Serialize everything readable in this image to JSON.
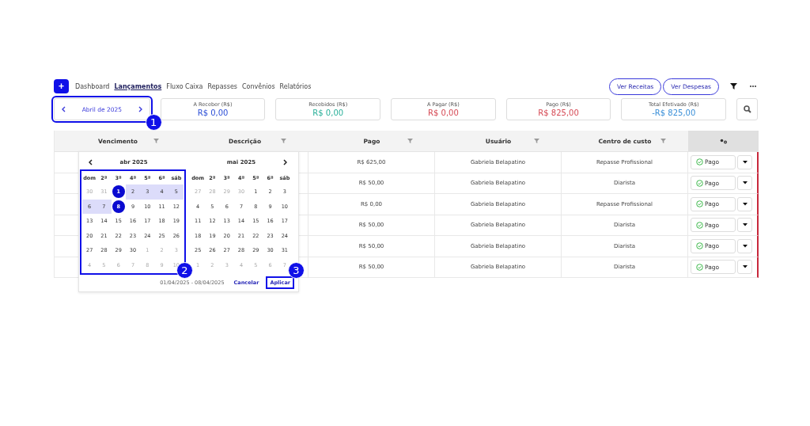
{
  "nav": {
    "add_label": "+",
    "links": [
      {
        "label": "Dashboard",
        "selected": false
      },
      {
        "label": "Lançamentos",
        "selected": true
      },
      {
        "label": "Fluxo Caixa",
        "selected": false
      },
      {
        "label": "Repasses",
        "selected": false
      },
      {
        "label": "Convênios",
        "selected": false
      },
      {
        "label": "Relatórios",
        "selected": false
      }
    ],
    "buttons": [
      "Ver Receitas",
      "Ver Despesas"
    ]
  },
  "month_nav": {
    "label": "Abril de 2025",
    "callout": "1"
  },
  "summary": [
    {
      "label": "A Receber (R$)",
      "value": "R$ 0,00",
      "color": "#2d4fd6"
    },
    {
      "label": "Recebidos (R$)",
      "value": "R$ 0,00",
      "color": "#2ab09a"
    },
    {
      "label": "A Pagar (R$)",
      "value": "R$ 0,00",
      "color": "#d64a55"
    },
    {
      "label": "Pago (R$)",
      "value": "R$ 825,00",
      "color": "#d64a55"
    },
    {
      "label": "Total Efetivado (R$)",
      "value": "-R$ 825,00",
      "color": "#3a8fd8"
    }
  ],
  "table": {
    "columns": [
      "Vencimento",
      "Descrição",
      "Pago",
      "Usuário",
      "Centro de custo"
    ],
    "rows": [
      {
        "pago": "R$ 625,00",
        "usuario": "Gabriela Belapatino",
        "centro": "Repasse Profissional",
        "status": "Pago",
        "color": "#c8283c"
      },
      {
        "pago": "R$ 50,00",
        "usuario": "Gabriela Belapatino",
        "centro": "Diarista",
        "status": "Pago",
        "color": "#c8283c"
      },
      {
        "pago": "R$ 0,00",
        "usuario": "Gabriela Belapatino",
        "centro": "Repasse Profissional",
        "status": "Pago",
        "color": "#c8283c"
      },
      {
        "pago": "R$ 50,00",
        "usuario": "Gabriela Belapatino",
        "centro": "Diarista",
        "status": "Pago",
        "color": "#c8283c"
      },
      {
        "pago": "R$ 50,00",
        "usuario": "Gabriela Belapatino",
        "centro": "Diarista",
        "status": "Pago",
        "color": "#c8283c"
      },
      {
        "pago": "R$ 50,00",
        "usuario": "Gabriela Belapatino",
        "centro": "Diarista",
        "status": "Pago",
        "color": "#c8283c"
      }
    ]
  },
  "datepicker": {
    "months": [
      {
        "title": "abr 2025",
        "callout": "2",
        "weekdays": [
          "dom",
          "2ª",
          "3ª",
          "4ª",
          "5ª",
          "6ª",
          "sáb"
        ],
        "days": [
          {
            "day": "30",
            "kind": "outside",
            "selected": false,
            "in_range": false
          },
          {
            "day": "31",
            "kind": "outside",
            "selected": false,
            "in_range": false
          },
          {
            "day": "1",
            "kind": "inside",
            "selected": true,
            "in_range": false
          },
          {
            "day": "2",
            "kind": "inside",
            "selected": false,
            "in_range": true
          },
          {
            "day": "3",
            "kind": "inside",
            "selected": false,
            "in_range": true
          },
          {
            "day": "4",
            "kind": "inside",
            "selected": false,
            "in_range": true
          },
          {
            "day": "5",
            "kind": "inside",
            "selected": false,
            "in_range": true
          },
          {
            "day": "6",
            "kind": "inside",
            "selected": false,
            "in_range": true
          },
          {
            "day": "7",
            "kind": "inside",
            "selected": false,
            "in_range": true
          },
          {
            "day": "8",
            "kind": "inside",
            "selected": true,
            "in_range": false
          },
          {
            "day": "9",
            "kind": "inside",
            "selected": false,
            "in_range": false
          },
          {
            "day": "10",
            "kind": "inside",
            "selected": false,
            "in_range": false
          },
          {
            "day": "11",
            "kind": "inside",
            "selected": false,
            "in_range": false
          },
          {
            "day": "12",
            "kind": "inside",
            "selected": false,
            "in_range": false
          },
          {
            "day": "13",
            "kind": "inside",
            "selected": false,
            "in_range": false
          },
          {
            "day": "14",
            "kind": "inside",
            "selected": false,
            "in_range": false
          },
          {
            "day": "15",
            "kind": "inside",
            "selected": false,
            "in_range": false
          },
          {
            "day": "16",
            "kind": "inside",
            "selected": false,
            "in_range": false
          },
          {
            "day": "17",
            "kind": "inside",
            "selected": false,
            "in_range": false
          },
          {
            "day": "18",
            "kind": "inside",
            "selected": false,
            "in_range": false
          },
          {
            "day": "19",
            "kind": "inside",
            "selected": false,
            "in_range": false
          },
          {
            "day": "20",
            "kind": "inside",
            "selected": false,
            "in_range": false
          },
          {
            "day": "21",
            "kind": "inside",
            "selected": false,
            "in_range": false
          },
          {
            "day": "22",
            "kind": "inside",
            "selected": false,
            "in_range": false
          },
          {
            "day": "23",
            "kind": "inside",
            "selected": false,
            "in_range": false
          },
          {
            "day": "24",
            "kind": "inside",
            "selected": false,
            "in_range": false
          },
          {
            "day": "25",
            "kind": "inside",
            "selected": false,
            "in_range": false
          },
          {
            "day": "26",
            "kind": "inside",
            "selected": false,
            "in_range": false
          },
          {
            "day": "27",
            "kind": "inside",
            "selected": false,
            "in_range": false
          },
          {
            "day": "28",
            "kind": "inside",
            "selected": false,
            "in_range": false
          },
          {
            "day": "29",
            "kind": "inside",
            "selected": false,
            "in_range": false
          },
          {
            "day": "30",
            "kind": "inside",
            "selected": false,
            "in_range": false
          },
          {
            "day": "1",
            "kind": "outside",
            "selected": false,
            "in_range": false
          },
          {
            "day": "2",
            "kind": "outside",
            "selected": false,
            "in_range": false
          },
          {
            "day": "3",
            "kind": "outside",
            "selected": false,
            "in_range": false
          },
          {
            "day": "4",
            "kind": "outside",
            "selected": false,
            "in_range": false
          },
          {
            "day": "5",
            "kind": "outside",
            "selected": false,
            "in_range": false
          },
          {
            "day": "6",
            "kind": "outside",
            "selected": false,
            "in_range": false
          },
          {
            "day": "7",
            "kind": "outside",
            "selected": false,
            "in_range": false
          },
          {
            "day": "8",
            "kind": "outside",
            "selected": false,
            "in_range": false
          },
          {
            "day": "9",
            "kind": "outside",
            "selected": false,
            "in_range": false
          },
          {
            "day": "10",
            "kind": "outside",
            "selected": false,
            "in_range": false
          }
        ]
      },
      {
        "title": "mai 2025",
        "weekdays": [
          "dom",
          "2ª",
          "3ª",
          "4ª",
          "5ª",
          "6ª",
          "sáb"
        ],
        "days": [
          {
            "day": "27",
            "kind": "outside",
            "selected": false,
            "in_range": false
          },
          {
            "day": "28",
            "kind": "outside",
            "selected": false,
            "in_range": false
          },
          {
            "day": "29",
            "kind": "outside",
            "selected": false,
            "in_range": false
          },
          {
            "day": "30",
            "kind": "outside",
            "selected": false,
            "in_range": false
          },
          {
            "day": "1",
            "kind": "inside",
            "selected": false,
            "in_range": false
          },
          {
            "day": "2",
            "kind": "inside",
            "selected": false,
            "in_range": false
          },
          {
            "day": "3",
            "kind": "inside",
            "selected": false,
            "in_range": false
          },
          {
            "day": "4",
            "kind": "inside",
            "selected": false,
            "in_range": false
          },
          {
            "day": "5",
            "kind": "inside",
            "selected": false,
            "in_range": false
          },
          {
            "day": "6",
            "kind": "inside",
            "selected": false,
            "in_range": false
          },
          {
            "day": "7",
            "kind": "inside",
            "selected": false,
            "in_range": false
          },
          {
            "day": "8",
            "kind": "inside",
            "selected": false,
            "in_range": false
          },
          {
            "day": "9",
            "kind": "inside",
            "selected": false,
            "in_range": false
          },
          {
            "day": "10",
            "kind": "inside",
            "selected": false,
            "in_range": false
          },
          {
            "day": "11",
            "kind": "inside",
            "selected": false,
            "in_range": false
          },
          {
            "day": "12",
            "kind": "inside",
            "selected": false,
            "in_range": false
          },
          {
            "day": "13",
            "kind": "inside",
            "selected": false,
            "in_range": false
          },
          {
            "day": "14",
            "kind": "inside",
            "selected": false,
            "in_range": false
          },
          {
            "day": "15",
            "kind": "inside",
            "selected": false,
            "in_range": false
          },
          {
            "day": "16",
            "kind": "inside",
            "selected": false,
            "in_range": false
          },
          {
            "day": "17",
            "kind": "inside",
            "selected": false,
            "in_range": false
          },
          {
            "day": "18",
            "kind": "inside",
            "selected": false,
            "in_range": false
          },
          {
            "day": "19",
            "kind": "inside",
            "selected": false,
            "in_range": false
          },
          {
            "day": "20",
            "kind": "inside",
            "selected": false,
            "in_range": false
          },
          {
            "day": "21",
            "kind": "inside",
            "selected": false,
            "in_range": false
          },
          {
            "day": "22",
            "kind": "inside",
            "selected": false,
            "in_range": false
          },
          {
            "day": "23",
            "kind": "inside",
            "selected": false,
            "in_range": false
          },
          {
            "day": "24",
            "kind": "inside",
            "selected": false,
            "in_range": false
          },
          {
            "day": "25",
            "kind": "inside",
            "selected": false,
            "in_range": false
          },
          {
            "day": "26",
            "kind": "inside",
            "selected": false,
            "in_range": false
          },
          {
            "day": "27",
            "kind": "inside",
            "selected": false,
            "in_range": false
          },
          {
            "day": "28",
            "kind": "inside",
            "selected": false,
            "in_range": false
          },
          {
            "day": "29",
            "kind": "inside",
            "selected": false,
            "in_range": false
          },
          {
            "day": "30",
            "kind": "inside",
            "selected": false,
            "in_range": false
          },
          {
            "day": "31",
            "kind": "inside",
            "selected": false,
            "in_range": false
          },
          {
            "day": "1",
            "kind": "outside",
            "selected": false,
            "in_range": false
          },
          {
            "day": "2",
            "kind": "outside",
            "selected": false,
            "in_range": false
          },
          {
            "day": "3",
            "kind": "outside",
            "selected": false,
            "in_range": false
          },
          {
            "day": "4",
            "kind": "outside",
            "selected": false,
            "in_range": false
          },
          {
            "day": "5",
            "kind": "outside",
            "selected": false,
            "in_range": false
          },
          {
            "day": "6",
            "kind": "outside",
            "selected": false,
            "in_range": false
          },
          {
            "day": "7",
            "kind": "outside",
            "selected": false,
            "in_range": false
          }
        ]
      }
    ],
    "range_text": "01/04/2025 - 08/04/2025",
    "cancel": "Cancelar",
    "apply": "Aplicar",
    "apply_callout": "3"
  }
}
